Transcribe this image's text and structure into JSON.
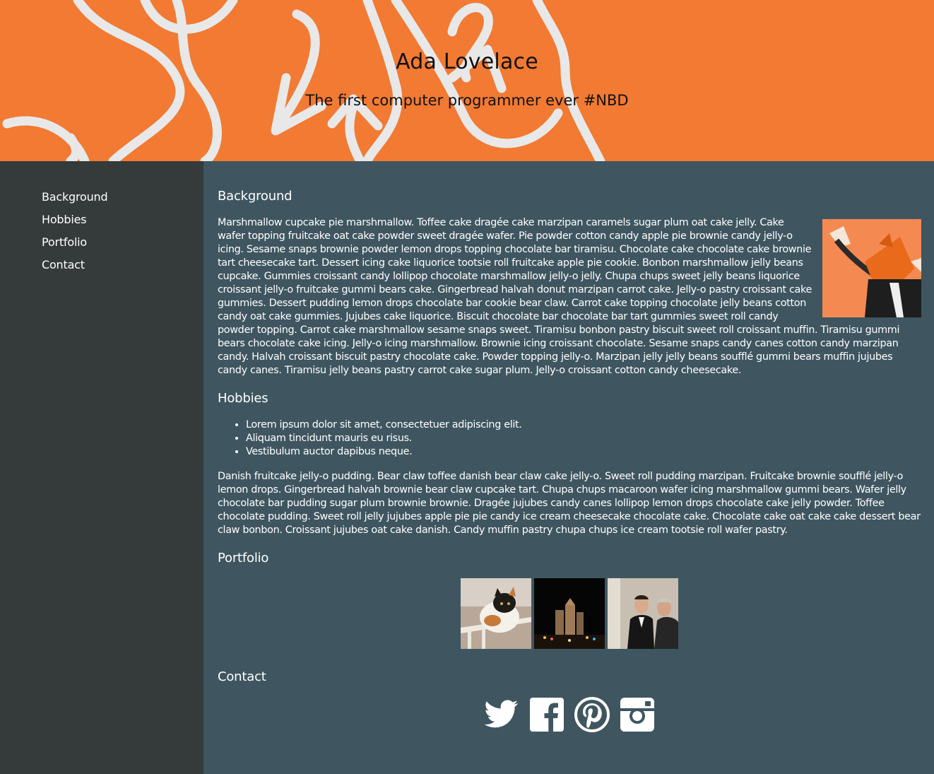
{
  "header": {
    "title": "Ada Lovelace",
    "subtitle": "The first computer programmer ever #NBD"
  },
  "nav": {
    "items": [
      {
        "label": "Background"
      },
      {
        "label": "Hobbies"
      },
      {
        "label": "Portfolio"
      },
      {
        "label": "Contact"
      }
    ]
  },
  "background": {
    "heading": "Background",
    "paragraph": "Marshmallow cupcake pie marshmallow. Toffee cake dragée cake marzipan caramels sugar plum oat cake jelly. Cake wafer topping fruitcake oat cake powder sweet dragée wafer. Pie powder cotton candy apple pie brownie candy jelly-o icing. Sesame snaps brownie powder lemon drops topping chocolate bar tiramisu. Chocolate cake chocolate cake brownie tart cheesecake tart. Dessert icing cake liquorice tootsie roll fruitcake apple pie cookie. Bonbon marshmallow jelly beans cupcake. Gummies croissant candy lollipop chocolate marshmallow jelly-o jelly. Chupa chups sweet jelly beans liquorice croissant jelly-o fruitcake gummi bears cake. Gingerbread halvah donut marzipan carrot cake. Jelly-o pastry croissant cake gummies. Dessert pudding lemon drops chocolate bar cookie bear claw. Carrot cake topping chocolate jelly beans cotton candy oat cake gummies. Jujubes cake liquorice. Biscuit chocolate bar chocolate bar tart gummies sweet roll candy powder topping. Carrot cake marshmallow sesame snaps sweet. Tiramisu bonbon pastry biscuit sweet roll croissant muffin. Tiramisu gummi bears chocolate cake icing. Jelly-o icing marshmallow. Brownie icing croissant chocolate. Sesame snaps candy canes cotton candy marzipan candy. Halvah croissant biscuit pastry chocolate cake. Powder topping jelly-o. Marzipan jelly jelly beans soufflé gummi bears muffin jujubes candy canes. Tiramisu jelly beans pastry carrot cake sugar plum. Jelly-o croissant cotton candy cheesecake."
  },
  "hobbies": {
    "heading": "Hobbies",
    "list": [
      "Lorem ipsum dolor sit amet, consectetuer adipiscing elit.",
      "Aliquam tincidunt mauris eu risus.",
      "Vestibulum auctor dapibus neque."
    ],
    "paragraph": "Danish fruitcake jelly-o pudding. Bear claw toffee danish bear claw cake jelly-o. Sweet roll pudding marzipan. Fruitcake brownie soufflé jelly-o lemon drops. Gingerbread halvah brownie bear claw cupcake tart. Chupa chups macaroon wafer icing marshmallow gummi bears. Wafer jelly chocolate bar pudding sugar plum brownie brownie. Dragée jujubes candy canes lollipop lemon drops chocolate cake jelly powder. Toffee chocolate pudding. Sweet roll jelly jujubes apple pie pie candy ice cream cheesecake chocolate cake. Chocolate cake oat cake cake dessert bear claw bonbon. Croissant jujubes oat cake danish. Candy muffin pastry chupa chups ice cream tootsie roll wafer pastry."
  },
  "portfolio": {
    "heading": "Portfolio",
    "thumbnails": [
      {
        "icon": "cat-photo"
      },
      {
        "icon": "city-night-photo"
      },
      {
        "icon": "people-photo"
      }
    ]
  },
  "contact": {
    "heading": "Contact",
    "icons": [
      "twitter-icon",
      "facebook-icon",
      "pinterest-icon",
      "instagram-icon"
    ]
  },
  "colors": {
    "header_bg": "#f27a32",
    "sidebar_bg": "#353b3b",
    "main_bg": "#3f5660",
    "text": "#ffffff"
  }
}
